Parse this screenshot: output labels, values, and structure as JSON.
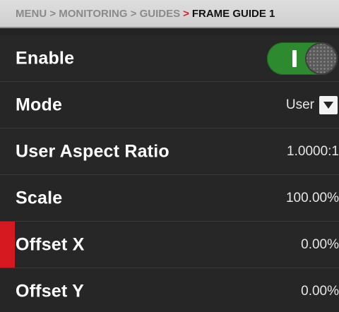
{
  "breadcrumb": {
    "path": "MENU > MONITORING > GUIDES",
    "separator": ">",
    "current": "FRAME GUIDE 1"
  },
  "rows": [
    {
      "label": "Enable",
      "control": "toggle",
      "state": "on"
    },
    {
      "label": "Mode",
      "control": "select",
      "value": "User",
      "icon": "chevron-down-icon"
    },
    {
      "label": "User Aspect Ratio",
      "value": "1.0000:1"
    },
    {
      "label": "Scale",
      "value": "100.00%"
    },
    {
      "label": "Offset X",
      "value": "0.00%",
      "selected": true
    },
    {
      "label": "Offset Y",
      "value": "0.00%"
    }
  ],
  "colors": {
    "accent_red": "#d61920",
    "toggle_green": "#2e8a2e",
    "background": "#262626",
    "breadcrumb_bg": "#d8d8d8"
  }
}
